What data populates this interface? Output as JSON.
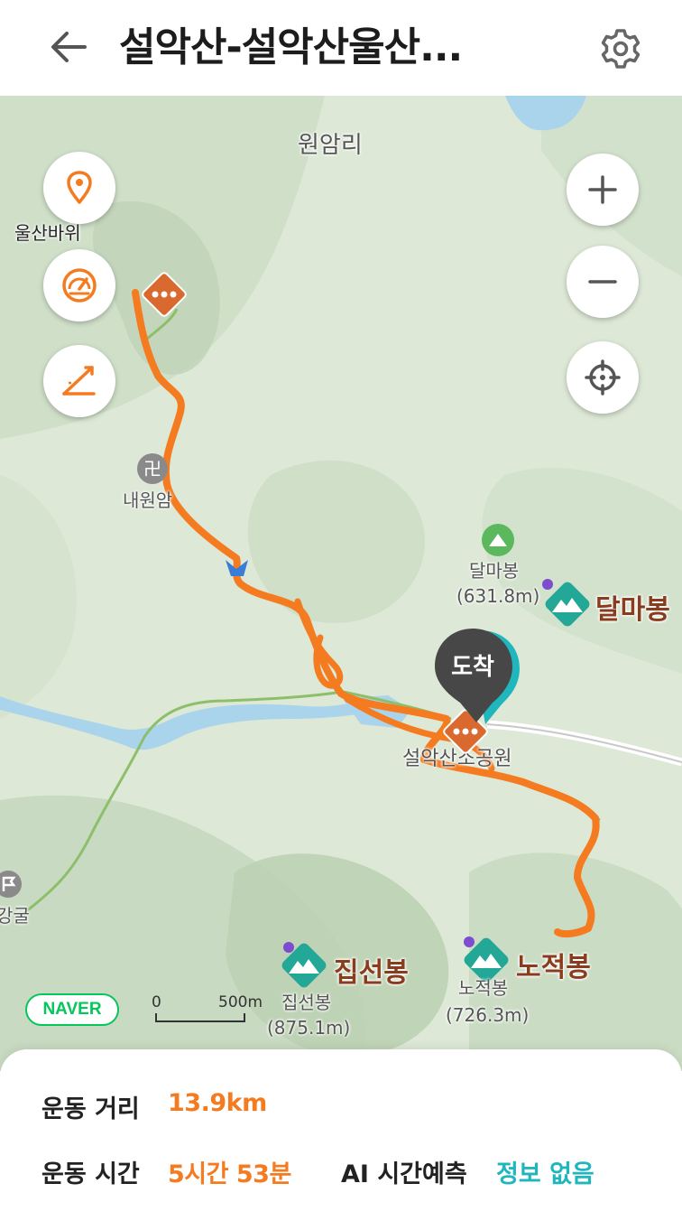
{
  "header": {
    "title": "설악산-설악산울산...",
    "back_icon": "arrow-left-icon",
    "settings_icon": "gear-icon"
  },
  "map": {
    "labels": {
      "village": "원암리",
      "temple": "내원암",
      "dalmabong_small": "달마봉",
      "dalmabong_elev": "(631.8m)",
      "dalmabong_big": "달마봉",
      "park": "설악산소공원",
      "jipseonbong_big": "집선봉",
      "jipseonbong_small": "집선봉",
      "jipseonbong_elev": "(875.1m)",
      "nojeokbong_big": "노적봉",
      "nojeokbong_small": "노적봉",
      "nojeokbong_elev": "(726.3m)",
      "cave": "강굴"
    },
    "side_buttons": {
      "waypoint_label": "울산바위",
      "waypoint_icon": "location-pin-icon",
      "speed_icon": "speedometer-icon",
      "slope_icon": "slope-icon"
    },
    "zoom_in_icon": "plus-icon",
    "zoom_out_icon": "minus-icon",
    "locate_icon": "crosshair-icon",
    "arrival": "도착",
    "naver": "NAVER",
    "scale_zero": "0",
    "scale_distance": "500m",
    "colors": {
      "route": "#f47b20",
      "marker": "#d9692f",
      "peak_teal": "#23a797",
      "water": "#a9d4ec",
      "trail": "#8dbf6a"
    }
  },
  "stats": {
    "distance_label": "운동 거리",
    "distance_value": "13.9km",
    "time_label": "운동 시간",
    "time_value": "5시간 53분",
    "ai_label": "AI 시간예측",
    "ai_value": "정보 없음"
  }
}
